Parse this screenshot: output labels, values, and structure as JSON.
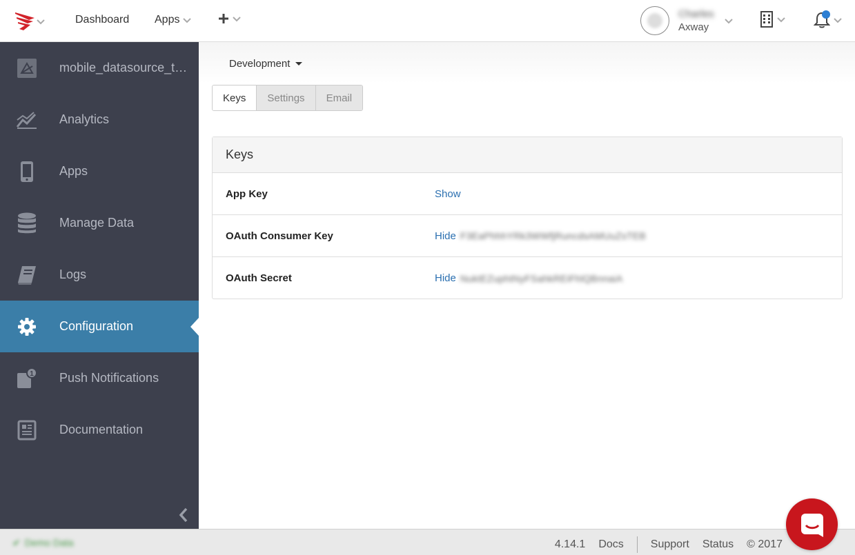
{
  "header": {
    "nav": {
      "dashboard": "Dashboard",
      "apps": "Apps"
    },
    "user": {
      "name": "Charles",
      "org": "Axway"
    }
  },
  "sidebar": {
    "items": [
      {
        "label": "mobile_datasource_t…",
        "icon": "app-image-icon"
      },
      {
        "label": "Analytics",
        "icon": "analytics-chart-icon"
      },
      {
        "label": "Apps",
        "icon": "mobile-phone-icon"
      },
      {
        "label": "Manage Data",
        "icon": "database-icon"
      },
      {
        "label": "Logs",
        "icon": "logbook-icon"
      },
      {
        "label": "Configuration",
        "icon": "gear-icon",
        "active": true
      },
      {
        "label": "Push Notifications",
        "icon": "notification-badge-icon",
        "badge": "1"
      },
      {
        "label": "Documentation",
        "icon": "document-icon"
      }
    ]
  },
  "main": {
    "environment": "Development",
    "tabs": [
      {
        "label": "Keys",
        "active": true
      },
      {
        "label": "Settings",
        "active": false
      },
      {
        "label": "Email",
        "active": false
      }
    ],
    "panel": {
      "title": "Keys",
      "rows": [
        {
          "label": "App Key",
          "action": "Show",
          "value": ""
        },
        {
          "label": "OAuth Consumer Key",
          "action": "Hide",
          "value": "F3EaPhhhYRk3WWfjRuncdsAMUuZsTEB"
        },
        {
          "label": "OAuth Secret",
          "action": "Hide",
          "value": "NuktEZuphtNyFSahkREiFhlQBnnaiA"
        }
      ]
    }
  },
  "footer": {
    "status": "Demo Data",
    "version": "4.14.1",
    "docs": "Docs",
    "support": "Support",
    "status_link": "Status",
    "copyright": "© 2017"
  },
  "colors": {
    "sidebar_bg": "#3d404d",
    "active_item": "#3b7ea8",
    "link": "#2a6fb0",
    "brand_red": "#c8161d",
    "notification_dot": "#2d7fd3"
  }
}
